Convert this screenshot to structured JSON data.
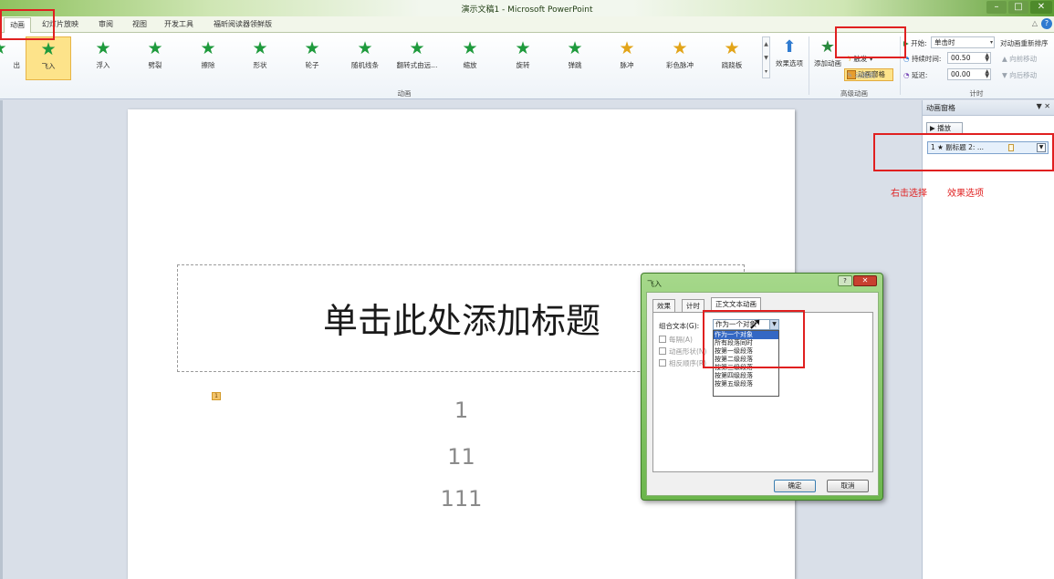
{
  "window": {
    "title": "演示文稿1 - Microsoft PowerPoint",
    "controls": {
      "minimize": "–",
      "maximize": "□",
      "close": "✕"
    }
  },
  "tabs": [
    {
      "label": "动画",
      "active": true
    },
    {
      "label": "幻灯片放映"
    },
    {
      "label": "审阅"
    },
    {
      "label": "视图"
    },
    {
      "label": "开发工具"
    },
    {
      "label": "福昕阅读器领鲜版"
    }
  ],
  "ribbon": {
    "gallery": [
      {
        "label": "出",
        "icon": "star-icon"
      },
      {
        "label": "飞入",
        "icon": "star-icon",
        "selected": true
      },
      {
        "label": "浮入",
        "icon": "star-icon"
      },
      {
        "label": "劈裂",
        "icon": "star-icon"
      },
      {
        "label": "擦除",
        "icon": "star-icon"
      },
      {
        "label": "形状",
        "icon": "star-icon"
      },
      {
        "label": "轮子",
        "icon": "star-icon"
      },
      {
        "label": "随机线条",
        "icon": "star-icon"
      },
      {
        "label": "翻转式由远...",
        "icon": "star-icon"
      },
      {
        "label": "缩放",
        "icon": "star-icon"
      },
      {
        "label": "旋转",
        "icon": "star-icon"
      },
      {
        "label": "弹跳",
        "icon": "star-icon"
      },
      {
        "label": "脉冲",
        "icon": "star-icon"
      },
      {
        "label": "彩色脉冲",
        "icon": "star-icon"
      },
      {
        "label": "跷跷板",
        "icon": "star-icon"
      }
    ],
    "effect_options": "效果选项",
    "group_animation": "动画",
    "add_animation": "添加动画",
    "animation_pane": "动画窗格",
    "trigger": "触发",
    "animation_painter": "动画刷",
    "group_advanced": "高级动画",
    "start_label": "开始:",
    "start_value": "单击时",
    "duration_label": "持续时间:",
    "duration_value": "00.50",
    "delay_label": "延迟:",
    "delay_value": "00.00",
    "reorder_title": "对动画重新排序",
    "move_earlier": "向前移动",
    "move_later": "向后移动",
    "group_timing": "计时"
  },
  "slide": {
    "title_placeholder": "单击此处添加标题",
    "anim_tag": "1",
    "body_lines": [
      "1",
      "11",
      "111"
    ]
  },
  "anim_pane": {
    "header": "动画窗格",
    "header_controls": "▼ ✕",
    "play": "▶ 播放",
    "item": "1 ★ 副标题 2: ..."
  },
  "annotations": {
    "right_click": "右击选择",
    "effect_options": "效果选项"
  },
  "dialog": {
    "title": "飞入",
    "help": "?",
    "close": "✕",
    "tabs": [
      {
        "label": "效果"
      },
      {
        "label": "计时"
      },
      {
        "label": "正文文本动画",
        "active": true
      }
    ],
    "group_text_label": "组合文本(G):",
    "group_text_value": "作为一个对象",
    "options": [
      "作为一个对象",
      "所有段落同时",
      "按第一级段落",
      "按第二级段落",
      "按第三级段落",
      "按第四级段落",
      "按第五级段落"
    ],
    "every_label": "每隔(A)",
    "attached_shape_label": "动画形状(N)",
    "reverse_order_label": "相反顺序(R)",
    "ok": "确定",
    "cancel": "取消"
  },
  "colors": {
    "annotation_red": "#e02020",
    "selected_gallery": "#fde38a",
    "dialog_chrome": "#6bb64c"
  }
}
